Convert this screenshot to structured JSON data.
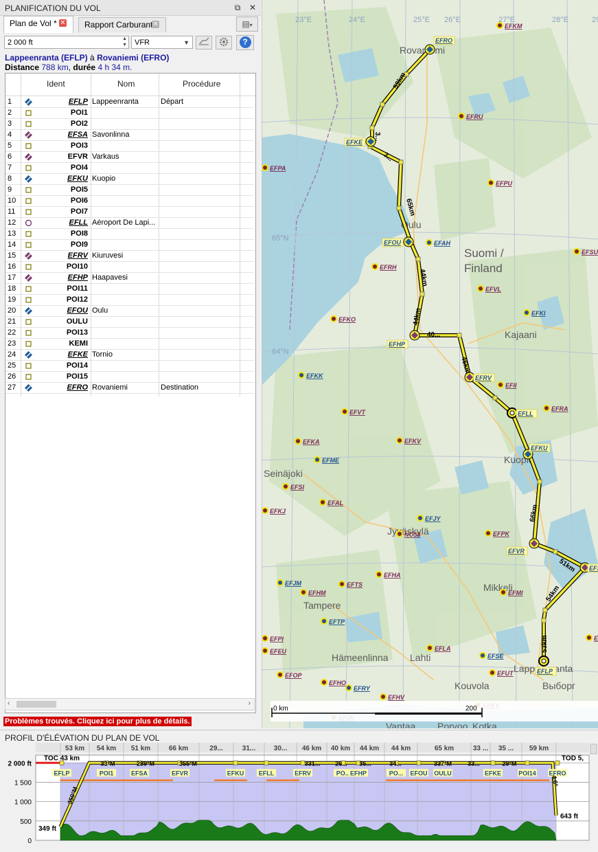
{
  "panel": {
    "title": "PLANIFICATION DU VOL",
    "float_icon": "⧉",
    "close_icon": "✕",
    "tabs": [
      {
        "label": "Plan de Vol *"
      },
      {
        "label": "Rapport Carburant"
      }
    ],
    "menu_icon": "▤"
  },
  "toolbar": {
    "altitude_value": "2 000 ft",
    "flight_rules_value": "VFR",
    "help_label": "?"
  },
  "route": {
    "from": "Lappeenranta (EFLP)",
    "connector": "à",
    "to": "Rovaniemi (EFRO)",
    "distance_label": "Distance",
    "distance_value": "788 km",
    "duration_label": "durée",
    "duration_value": "4 h 34 m."
  },
  "table": {
    "columns": [
      "Ident",
      "Nom",
      "Procédure"
    ],
    "rows": [
      {
        "n": "1",
        "ident": "EFLP",
        "nom": "Lappeenranta",
        "proc": "Départ",
        "type": "airport-blue",
        "italic": true
      },
      {
        "n": "2",
        "ident": "POI1",
        "nom": "",
        "proc": "",
        "type": "poi",
        "italic": false
      },
      {
        "n": "3",
        "ident": "POI2",
        "nom": "",
        "proc": "",
        "type": "poi",
        "italic": false
      },
      {
        "n": "4",
        "ident": "EFSA",
        "nom": "Savonlinna",
        "proc": "",
        "type": "airport-purple",
        "italic": true
      },
      {
        "n": "5",
        "ident": "POI3",
        "nom": "",
        "proc": "",
        "type": "poi",
        "italic": false
      },
      {
        "n": "6",
        "ident": "EFVR",
        "nom": "Varkaus",
        "proc": "",
        "type": "airport-purple",
        "italic": false
      },
      {
        "n": "7",
        "ident": "POI4",
        "nom": "",
        "proc": "",
        "type": "poi",
        "italic": false
      },
      {
        "n": "8",
        "ident": "EFKU",
        "nom": "Kuopio",
        "proc": "",
        "type": "airport-blue",
        "italic": true
      },
      {
        "n": "9",
        "ident": "POI5",
        "nom": "",
        "proc": "",
        "type": "poi",
        "italic": false
      },
      {
        "n": "10",
        "ident": "POI6",
        "nom": "",
        "proc": "",
        "type": "poi",
        "italic": false
      },
      {
        "n": "11",
        "ident": "POI7",
        "nom": "",
        "proc": "",
        "type": "poi",
        "italic": false
      },
      {
        "n": "12",
        "ident": "EFLL",
        "nom": "Aéroport De Lapi...",
        "proc": "",
        "type": "airport-circle",
        "italic": true
      },
      {
        "n": "13",
        "ident": "POI8",
        "nom": "",
        "proc": "",
        "type": "poi",
        "italic": false
      },
      {
        "n": "14",
        "ident": "POI9",
        "nom": "",
        "proc": "",
        "type": "poi",
        "italic": false
      },
      {
        "n": "15",
        "ident": "EFRV",
        "nom": "Kiuruvesi",
        "proc": "",
        "type": "airport-purple",
        "italic": true
      },
      {
        "n": "16",
        "ident": "POI10",
        "nom": "",
        "proc": "",
        "type": "poi",
        "italic": false
      },
      {
        "n": "17",
        "ident": "EFHP",
        "nom": "Haapavesi",
        "proc": "",
        "type": "airport-purple",
        "italic": true
      },
      {
        "n": "18",
        "ident": "POI11",
        "nom": "",
        "proc": "",
        "type": "poi",
        "italic": false
      },
      {
        "n": "19",
        "ident": "POI12",
        "nom": "",
        "proc": "",
        "type": "poi",
        "italic": false
      },
      {
        "n": "20",
        "ident": "EFOU",
        "nom": "Oulu",
        "proc": "",
        "type": "airport-blue",
        "italic": true
      },
      {
        "n": "21",
        "ident": "OULU",
        "nom": "",
        "proc": "",
        "type": "poi",
        "italic": false
      },
      {
        "n": "22",
        "ident": "POI13",
        "nom": "",
        "proc": "",
        "type": "poi",
        "italic": false
      },
      {
        "n": "23",
        "ident": "KEMI",
        "nom": "",
        "proc": "",
        "type": "poi",
        "italic": false
      },
      {
        "n": "24",
        "ident": "EFKE",
        "nom": "Tornio",
        "proc": "",
        "type": "airport-blue",
        "italic": true
      },
      {
        "n": "25",
        "ident": "POI14",
        "nom": "",
        "proc": "",
        "type": "poi",
        "italic": false
      },
      {
        "n": "26",
        "ident": "POI15",
        "nom": "",
        "proc": "",
        "type": "poi",
        "italic": false
      },
      {
        "n": "27",
        "ident": "EFRO",
        "nom": "Rovaniemi",
        "proc": "Destination",
        "type": "airport-blue",
        "italic": true
      }
    ]
  },
  "problems_text": "Problèmes trouvés. Cliquez ici pour plus de détails.",
  "map": {
    "lon_labels": [
      "23°E",
      "24°E",
      "25°E",
      "26°E",
      "27°E",
      "28°E",
      "29°"
    ],
    "lat_labels": [
      "65°N",
      "64°N"
    ],
    "places": [
      {
        "name": "Rovaniemi",
        "kind": "city"
      },
      {
        "name": "Oulu",
        "kind": "city"
      },
      {
        "name": "Suomi /",
        "kind": "country"
      },
      {
        "name": "Finland",
        "kind": "country"
      },
      {
        "name": "Kajaani",
        "kind": "city"
      },
      {
        "name": "Kuopio",
        "kind": "city"
      },
      {
        "name": "Seinäjoki",
        "kind": "city"
      },
      {
        "name": "Jyväskylä",
        "kind": "city"
      },
      {
        "name": "Mikkeli",
        "kind": "city"
      },
      {
        "name": "Tampere",
        "kind": "city"
      },
      {
        "name": "Hämeenlinna",
        "kind": "city"
      },
      {
        "name": "Lahti",
        "kind": "city"
      },
      {
        "name": "Kouvola",
        "kind": "city"
      },
      {
        "name": "Lappeenranta",
        "kind": "city"
      },
      {
        "name": "Выборг",
        "kind": "city"
      },
      {
        "name": "Porvoo",
        "kind": "city"
      },
      {
        "name": "Kotka",
        "kind": "city"
      },
      {
        "name": "Vantaa",
        "kind": "city"
      }
    ],
    "leg_labels": [
      "59km",
      "3...",
      "3...",
      "65km",
      "44km",
      "44km",
      "40...",
      "46km",
      "66km",
      "51km",
      "54km",
      "53km"
    ],
    "route_airports": [
      "EFRO",
      "EFKE",
      "EFOU",
      "EFHP",
      "EFRV",
      "EFLL",
      "EFKU",
      "EFVR",
      "EFSA",
      "EFLP"
    ],
    "other_airports": [
      "EFKM",
      "EFRU",
      "EFPU",
      "EFAH",
      "EFSU",
      "EFRH",
      "EFVL",
      "EFKI",
      "EFKO",
      "EFII",
      "EFRA",
      "EFKK",
      "EFVT",
      "EFKA",
      "EFKV",
      "EFME",
      "EFSI",
      "EFAL",
      "EFKJ",
      "EFJY",
      "NO58",
      "EFPK",
      "EFHA",
      "EFJM",
      "EFTS",
      "EFHM",
      "EFMI",
      "EFTP",
      "EFPI",
      "EFEU",
      "EFLA",
      "EFSE",
      "EFUT",
      "EFOP",
      "EFHO",
      "EFRY",
      "EFHV",
      "EFKY",
      "EFPA",
      "EFJK",
      "EFIF"
    ],
    "scale_start": "0 km",
    "scale_end": "200"
  },
  "profile": {
    "title": "PROFIL D'ÉLÉVATION DU PLAN DE VOL",
    "leg_distances": [
      "53 km",
      "54 km",
      "51 km",
      "66 km",
      "29...",
      "31...",
      "30...",
      "46 km",
      "40 km",
      "44 km",
      "44 km",
      "65 km",
      "33 ...",
      "35 ...",
      "59 km"
    ],
    "y_ticks": [
      "2 000 ft",
      "1 500",
      "1 000",
      "500",
      "0"
    ],
    "toc": "TOC 43 km",
    "tod": "TOD 5,",
    "heading_labels": [
      "33°M",
      "289°M",
      "355°M",
      "331...",
      "26...",
      "35...",
      "34...",
      "337°M",
      "33...",
      "29°M"
    ],
    "wp_labels": [
      "EFLP",
      "POI1",
      "EFSA",
      "EFVR",
      "EFKU",
      "EFLL",
      "EFRV",
      "PO...",
      "EFHP",
      "PO...",
      "EFOU",
      "OULU",
      "EFKE",
      "POI14",
      "EFRO"
    ],
    "climb_label": "350°M",
    "descent_label": "4.6°",
    "start_elev": "349 ft",
    "end_elev": "643 ft"
  }
}
